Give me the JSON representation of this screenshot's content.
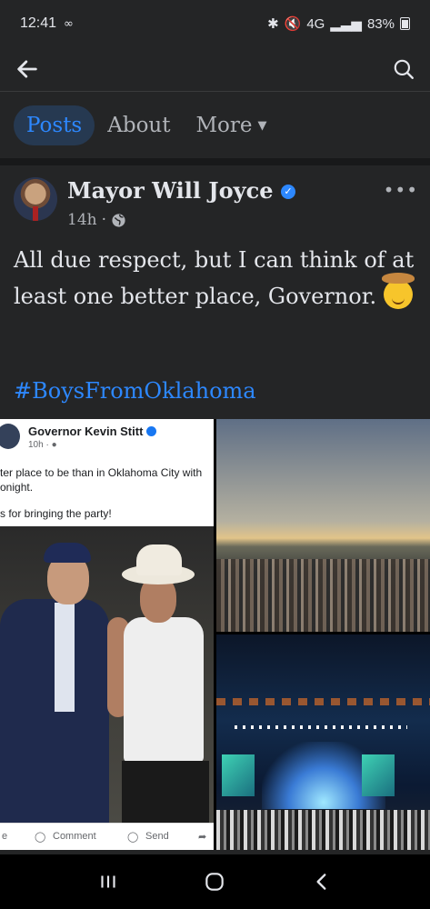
{
  "status_bar": {
    "time": "12:41",
    "voicemail_icon": "voicemail-icon",
    "network": "4G",
    "battery": "83%"
  },
  "topbar": {
    "back_icon": "arrow-left-icon",
    "search_icon": "search-icon"
  },
  "tabs": [
    {
      "label": "Posts",
      "active": true
    },
    {
      "label": "About",
      "active": false
    },
    {
      "label": "More",
      "active": false
    }
  ],
  "post": {
    "author": "Mayor Will Joyce",
    "time": "14h",
    "privacy_icon": "globe-icon",
    "text": "All due respect, but I can think of at least one better place, Governor.",
    "emoji": "cowboy-emoji",
    "hashtag": "#BoysFromOklahoma"
  },
  "shared_screenshot": {
    "author": "Governor Kevin Stitt",
    "time": "10h",
    "line1": "ter place to be than in Oklahoma City with",
    "line2": "onight.",
    "line3": "s for bringing the party!",
    "action_like": "e",
    "action_comment": "Comment",
    "action_send": "Send"
  },
  "colors": {
    "background": "#242526",
    "accent": "#2d88ff",
    "active_tab_bg": "#263951"
  }
}
